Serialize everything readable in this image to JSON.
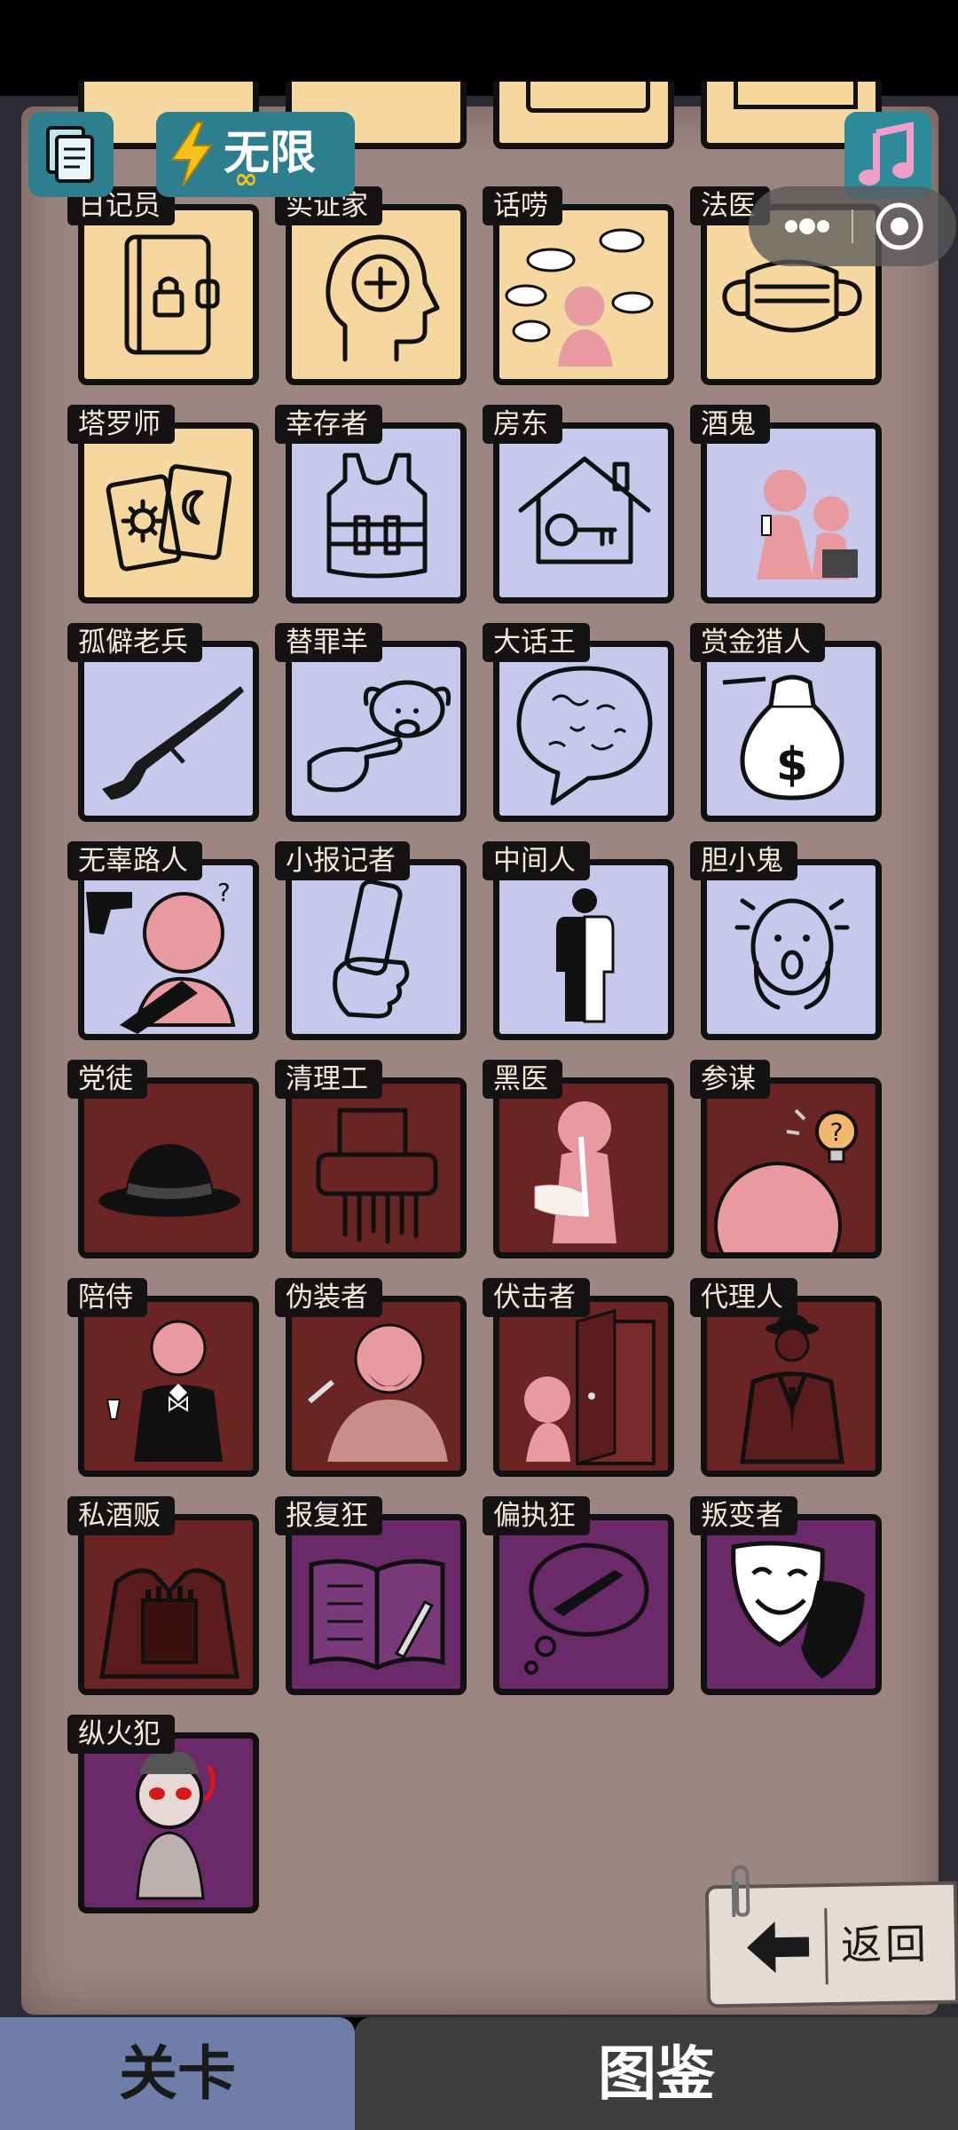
{
  "energy_label": "无限",
  "energy_sub": "∞",
  "back_label": "返回",
  "tabs": [
    "关卡",
    "图鉴"
  ],
  "roles": [
    {
      "name": "日记员",
      "color": "yellow",
      "icon": "diary-icon"
    },
    {
      "name": "实证家",
      "color": "yellow",
      "icon": "head-plus-icon"
    },
    {
      "name": "话唠",
      "color": "yellow",
      "icon": "chatter-icon"
    },
    {
      "name": "法医",
      "color": "yellow",
      "icon": "mask-icon"
    },
    {
      "name": "塔罗师",
      "color": "yellow",
      "icon": "tarot-cards-icon"
    },
    {
      "name": "幸存者",
      "color": "lav",
      "icon": "vest-icon"
    },
    {
      "name": "房东",
      "color": "lav",
      "icon": "house-key-icon"
    },
    {
      "name": "酒鬼",
      "color": "lav",
      "icon": "drunk-icon"
    },
    {
      "name": "孤僻老兵",
      "color": "lav",
      "icon": "rifle-icon"
    },
    {
      "name": "替罪羊",
      "color": "lav",
      "icon": "sheep-point-icon"
    },
    {
      "name": "大话王",
      "color": "lav",
      "icon": "speech-bubble-icon"
    },
    {
      "name": "赏金猎人",
      "color": "lav",
      "icon": "money-bag-icon"
    },
    {
      "name": "无辜路人",
      "color": "lav",
      "icon": "bystander-icon"
    },
    {
      "name": "小报记者",
      "color": "lav",
      "icon": "newspaper-icon"
    },
    {
      "name": "中间人",
      "color": "lav",
      "icon": "half-person-icon"
    },
    {
      "name": "胆小鬼",
      "color": "lav",
      "icon": "scared-face-icon"
    },
    {
      "name": "党徒",
      "color": "maroon",
      "icon": "fedora-icon"
    },
    {
      "name": "清理工",
      "color": "maroon",
      "icon": "shredder-icon"
    },
    {
      "name": "黑医",
      "color": "maroon",
      "icon": "doctor-icon"
    },
    {
      "name": "参谋",
      "color": "maroon",
      "icon": "advisor-icon"
    },
    {
      "name": "陪侍",
      "color": "maroon",
      "icon": "butler-icon"
    },
    {
      "name": "伪装者",
      "color": "maroon",
      "icon": "disguise-icon"
    },
    {
      "name": "伏击者",
      "color": "maroon",
      "icon": "ambush-door-icon"
    },
    {
      "name": "代理人",
      "color": "maroon",
      "icon": "suit-agent-icon"
    },
    {
      "name": "私酒贩",
      "color": "maroon",
      "icon": "bottles-coat-icon"
    },
    {
      "name": "报复狂",
      "color": "purple",
      "icon": "book-knife-icon"
    },
    {
      "name": "偏执狂",
      "color": "purple",
      "icon": "knife-thought-icon"
    },
    {
      "name": "叛变者",
      "color": "purple",
      "icon": "theater-masks-icon"
    },
    {
      "name": "纵火犯",
      "color": "purple",
      "icon": "arsonist-icon"
    }
  ]
}
